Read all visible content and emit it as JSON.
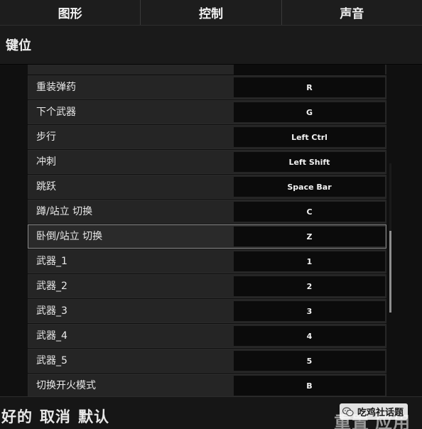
{
  "tabs": [
    {
      "label": "图形"
    },
    {
      "label": "控制"
    },
    {
      "label": "声音"
    }
  ],
  "section": {
    "title": "键位"
  },
  "bindings": [
    {
      "action": "重装弹药",
      "key": "R"
    },
    {
      "action": "下个武器",
      "key": "G"
    },
    {
      "action": "步行",
      "key": "Left Ctrl"
    },
    {
      "action": "冲刺",
      "key": "Left Shift"
    },
    {
      "action": "跳跃",
      "key": "Space Bar"
    },
    {
      "action": "蹲/站立 切换",
      "key": "C"
    },
    {
      "action": "卧倒/站立 切换",
      "key": "Z"
    },
    {
      "action": "武器_1",
      "key": "1"
    },
    {
      "action": "武器_2",
      "key": "2"
    },
    {
      "action": "武器_3",
      "key": "3"
    },
    {
      "action": "武器_4",
      "key": "4"
    },
    {
      "action": "武器_5",
      "key": "5"
    },
    {
      "action": "切换开火模式",
      "key": "B"
    }
  ],
  "highlighted_row": "卧倒/站立 切换",
  "bottom": {
    "ok": "好的",
    "cancel": "取消",
    "default": "默认",
    "reset": "重置",
    "apply": "应用"
  },
  "watermark": {
    "text": "吃鸡社话题",
    "icon": "wechat-icon"
  }
}
